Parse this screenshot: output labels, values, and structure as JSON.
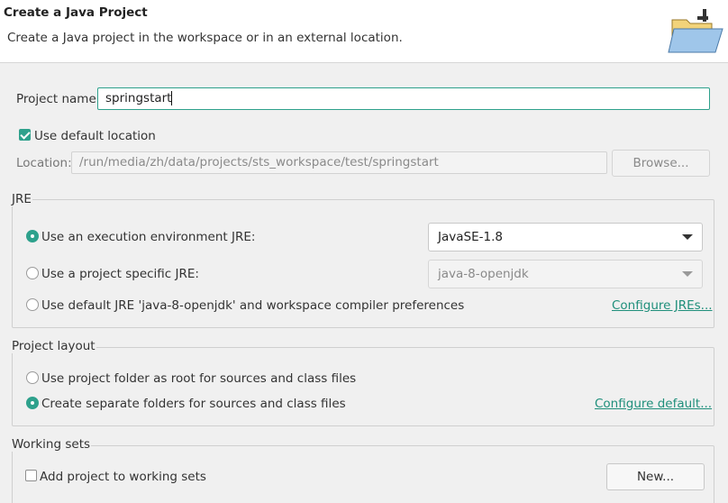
{
  "header": {
    "title": "Create a Java Project",
    "description": "Create a Java project in the workspace or in an external location.",
    "icon": "new-java-project-wizard-icon"
  },
  "project_name": {
    "label": "Project name:",
    "value": "springstart"
  },
  "location": {
    "use_default_label": "Use default location",
    "use_default_checked": true,
    "label": "Location:",
    "value": "/run/media/zh/data/projects/sts_workspace/test/springstart",
    "browse_label": "Browse..."
  },
  "jre": {
    "group_label": "JRE",
    "options": [
      {
        "label": "Use an execution environment JRE:",
        "selected": true
      },
      {
        "label": "Use a project specific JRE:",
        "selected": false
      },
      {
        "label": "Use default JRE 'java-8-openjdk' and workspace compiler preferences",
        "selected": false
      }
    ],
    "execution_env_value": "JavaSE-1.8",
    "project_specific_value": "java-8-openjdk",
    "configure_link": "Configure JREs..."
  },
  "project_layout": {
    "group_label": "Project layout",
    "options": [
      {
        "label": "Use project folder as root for sources and class files",
        "selected": false
      },
      {
        "label": "Create separate folders for sources and class files",
        "selected": true
      }
    ],
    "configure_link": "Configure default..."
  },
  "working_sets": {
    "group_label": "Working sets",
    "add_label": "Add project to working sets",
    "add_checked": false,
    "new_button": "New..."
  },
  "colors": {
    "accent": "#2ea18c",
    "link": "#1f8f7b"
  }
}
